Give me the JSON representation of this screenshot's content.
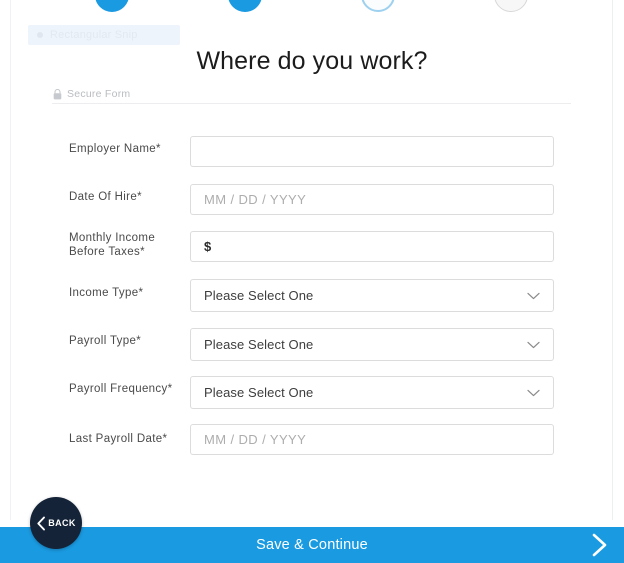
{
  "stepper": {
    "steps": [
      {
        "name": "step-1",
        "state": "done"
      },
      {
        "name": "step-2",
        "state": "done"
      },
      {
        "name": "step-3",
        "state": "current"
      },
      {
        "name": "step-4",
        "state": "todo"
      }
    ]
  },
  "snip_overlay": {
    "label": "Rectangular Snip",
    "icon": "snip-dot-icon"
  },
  "header": {
    "title": "Where do you work?",
    "secure_label": "Secure Form",
    "secure_icon": "lock-icon"
  },
  "form": {
    "fields": [
      {
        "label": "Employer Name*",
        "control": "text",
        "value": "",
        "placeholder": ""
      },
      {
        "label": "Date Of Hire*",
        "control": "text",
        "value": "",
        "placeholder": "MM / DD / YYYY"
      },
      {
        "label": "Monthly Income Before Taxes*",
        "label_line1": "Monthly Income",
        "label_line2": "Before Taxes*",
        "control": "text",
        "value": "$",
        "placeholder": ""
      },
      {
        "label": "Income Type*",
        "control": "select",
        "value": "Please Select One",
        "icon": "chevron-down-icon"
      },
      {
        "label": "Payroll Type*",
        "control": "select",
        "value": "Please Select One",
        "icon": "chevron-down-icon"
      },
      {
        "label": "Payroll Frequency*",
        "control": "select",
        "value": "Please Select One",
        "icon": "chevron-down-icon"
      },
      {
        "label": "Last Payroll Date*",
        "control": "text",
        "value": "",
        "placeholder": "MM / DD / YYYY"
      }
    ]
  },
  "footer": {
    "save_label": "Save & Continue",
    "next_icon": "chevron-right-icon",
    "back_label": "BACK",
    "back_icon": "chevron-left-icon"
  },
  "colors": {
    "accent_blue": "#1a9ae1",
    "back_navy": "#152338",
    "border_gray": "#dcdcdc",
    "placeholder_gray": "#adadad"
  }
}
